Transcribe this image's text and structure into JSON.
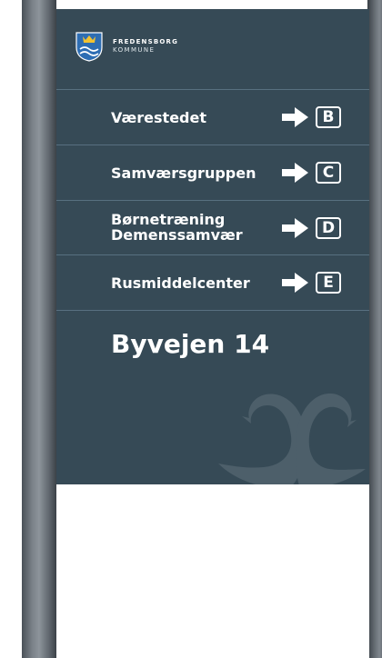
{
  "logo": {
    "line1": "FREDENSBORG",
    "line2": "KOMMUNE"
  },
  "rows": [
    {
      "label_lines": [
        "Værestedet"
      ],
      "letter": "B"
    },
    {
      "label_lines": [
        "Samværsgruppen"
      ],
      "letter": "C"
    },
    {
      "label_lines": [
        "Børnetræning",
        "Demenssamvær"
      ],
      "letter": "D"
    },
    {
      "label_lines": [
        "Rusmiddelcenter"
      ],
      "letter": "E"
    }
  ],
  "address": "Byvejen 14",
  "colors": {
    "panel": "#364a56",
    "divider": "#587080",
    "text": "#ffffff",
    "swan": "#4d5f6a"
  },
  "icons": {
    "crest": "fredensborg-crest-icon",
    "arrow": "arrow-right-icon",
    "swans": "swans-watermark-icon"
  }
}
